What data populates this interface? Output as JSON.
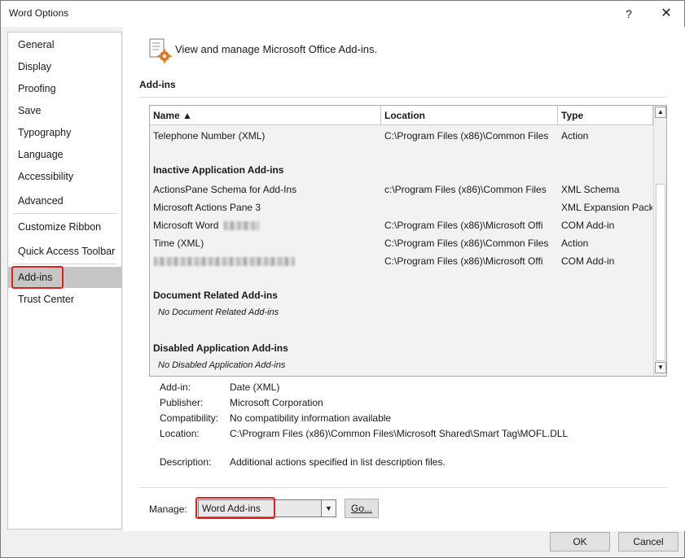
{
  "window": {
    "title": "Word Options",
    "help_glyph": "?",
    "close_glyph": "✕"
  },
  "sidebar": {
    "items": [
      {
        "label": "General"
      },
      {
        "label": "Display"
      },
      {
        "label": "Proofing"
      },
      {
        "label": "Save"
      },
      {
        "label": "Typography"
      },
      {
        "label": "Language"
      },
      {
        "label": "Accessibility"
      },
      {
        "label": "Advanced"
      },
      {
        "label": "Customize Ribbon"
      },
      {
        "label": "Quick Access Toolbar"
      },
      {
        "label": "Add-ins",
        "selected": true
      },
      {
        "label": "Trust Center"
      }
    ]
  },
  "header": {
    "text": "View and manage Microsoft Office Add-ins."
  },
  "section": {
    "label": "Add-ins"
  },
  "table": {
    "columns": {
      "name": "Name ▲",
      "location": "Location",
      "type": "Type"
    },
    "rows": [
      {
        "name": "Telephone Number (XML)",
        "location": "C:\\Program Files (x86)\\Common Files",
        "type": "Action"
      }
    ],
    "groups": {
      "inactive": "Inactive Application Add-ins",
      "document": "Document Related Add-ins",
      "disabled": "Disabled Application Add-ins"
    },
    "inactive_rows": [
      {
        "name": "ActionsPane Schema for Add-Ins",
        "location": "c:\\Program Files (x86)\\Common Files",
        "type": "XML Schema"
      },
      {
        "name": "Microsoft Actions Pane 3",
        "location": "",
        "type": "XML Expansion Pack"
      },
      {
        "name": "Microsoft Word",
        "location": "C:\\Program Files (x86)\\Microsoft Offi",
        "type": "COM Add-in",
        "blurred_suffix": true
      },
      {
        "name": "Time (XML)",
        "location": "C:\\Program Files (x86)\\Common Files",
        "type": "Action"
      },
      {
        "name": "",
        "location": "C:\\Program Files (x86)\\Microsoft Offi",
        "type": "COM Add-in",
        "blurred_name": true
      }
    ],
    "document_empty": "No Document Related Add-ins",
    "disabled_empty": "No Disabled Application Add-ins"
  },
  "details": {
    "addin_label": "Add-in:",
    "addin_value": "Date (XML)",
    "publisher_label": "Publisher:",
    "publisher_value": "Microsoft Corporation",
    "compat_label": "Compatibility:",
    "compat_value": "No compatibility information available",
    "location_label": "Location:",
    "location_value": "C:\\Program Files (x86)\\Common Files\\Microsoft Shared\\Smart Tag\\MOFL.DLL",
    "description_label": "Description:",
    "description_value": "Additional actions specified in list description files."
  },
  "manage": {
    "label": "Manage:",
    "selected": "Word Add-ins",
    "go_label": "Go..."
  },
  "footer": {
    "ok_label": "OK",
    "cancel_label": "Cancel"
  },
  "colors": {
    "highlight": "#e02020",
    "selected_nav": "#c6c6c6"
  }
}
